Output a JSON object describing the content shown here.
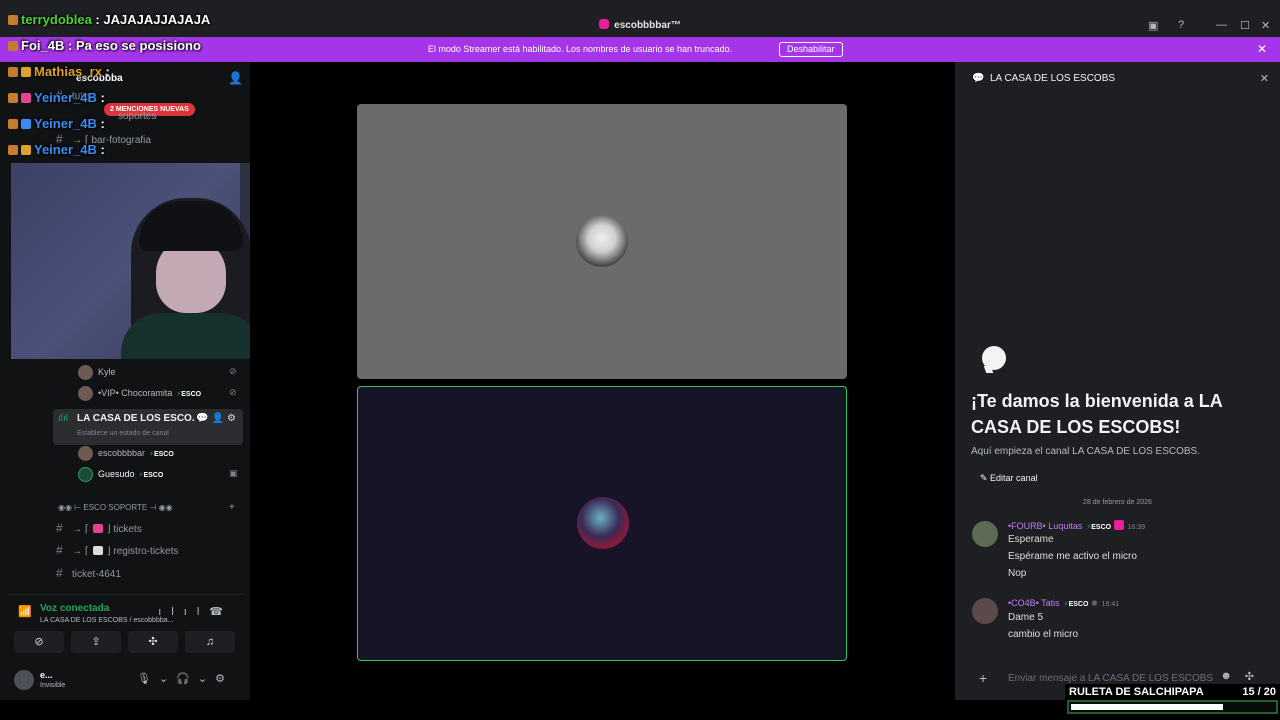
{
  "titlebar": {
    "app_title": "escobbbbar™",
    "controls": [
      "▣",
      "?",
      "—",
      "☐",
      "✕"
    ]
  },
  "banner": {
    "message": "El modo Streamer está habilitado. Los nombres de usuario se han truncado.",
    "disable_label": "Deshabilitar"
  },
  "sidebar": {
    "server_name": "escobbba",
    "mentions_pill": "2 MENCIONES NUEVAS",
    "channels_top": [
      {
        "name": "tutes"
      },
      {
        "name": "soportes"
      },
      {
        "name": "bar-fotografia"
      }
    ],
    "voice_users_top": [
      {
        "name": "Kyle",
        "tag": ""
      },
      {
        "name": "•VIP• Chocoramita",
        "tag": "ESCO"
      }
    ],
    "active_voice": {
      "name": "LA CASA DE LOS ESCO...",
      "status": "Establece un estado de canal"
    },
    "voice_users": [
      {
        "name": "escobbbbar",
        "tag": "ESCO"
      },
      {
        "name": "Guesudo",
        "tag": "ESCO"
      }
    ],
    "category": "◉◉ ⊢ ESCO SOPORTE ⊣ ◉◉",
    "channels_bottom": [
      {
        "prefix": "→ ⌈",
        "name": "tickets"
      },
      {
        "prefix": "→ ⌈",
        "name": "registro-tickets"
      },
      {
        "prefix": "",
        "name": "ticket-4641"
      }
    ]
  },
  "voice_panel": {
    "title": "Voz conectada",
    "subtitle": "LA CASA DE LOS ESCOBS / escobbbba..."
  },
  "user_panel": {
    "name": "e...",
    "status": "Invisible"
  },
  "stream_chat": [
    {
      "user": "terrydoblea",
      "color": "#4cd137",
      "text": "JAJAJAJJAJAJA"
    },
    {
      "user": "Foi_4B",
      "color": "#ffffff",
      "text": "Pa eso se posisiono"
    },
    {
      "user": "Mathias_rx",
      "color": "#e0a030",
      "text": ""
    },
    {
      "user": "Yeiner_4B",
      "color": "#3a8df0",
      "text": ""
    },
    {
      "user": "Yeiner_4B",
      "color": "#3a8df0",
      "text": ""
    },
    {
      "user": "Yeiner_4B",
      "color": "#3a8df0",
      "text": ""
    }
  ],
  "thread_panel": {
    "title": "LA CASA DE LOS ESCOBS",
    "welcome_title": "¡Te damos la bienvenida a LA CASA DE LOS ESCOBS!",
    "welcome_sub": "Aquí empieza el canal LA CASA DE LOS ESCOBS.",
    "edit_label": "Editar canal",
    "date": "28 de febrero de 2026",
    "messages": [
      {
        "author": "•FOURB• Luquitas",
        "tag": "ESCO",
        "time": "16:39",
        "lines": [
          "Esperame",
          "Espérame me activo el micro",
          "Nop"
        ]
      },
      {
        "author": "•CO4B• Tatis",
        "tag": "ESCO",
        "time": "16:41",
        "lines": [
          "Dame 5",
          "cambio el micro"
        ]
      }
    ],
    "composer_placeholder": "Enviar mensaje a LA CASA DE LOS ESCOBS"
  },
  "roulette": {
    "label": "RULETA DE SALCHIPAPA",
    "count": "15  / 20",
    "progress": 0.75
  },
  "colors": {
    "banner": "#a535e8",
    "speaking_border": "#2ecc5c",
    "accent_green": "#23a55a"
  }
}
